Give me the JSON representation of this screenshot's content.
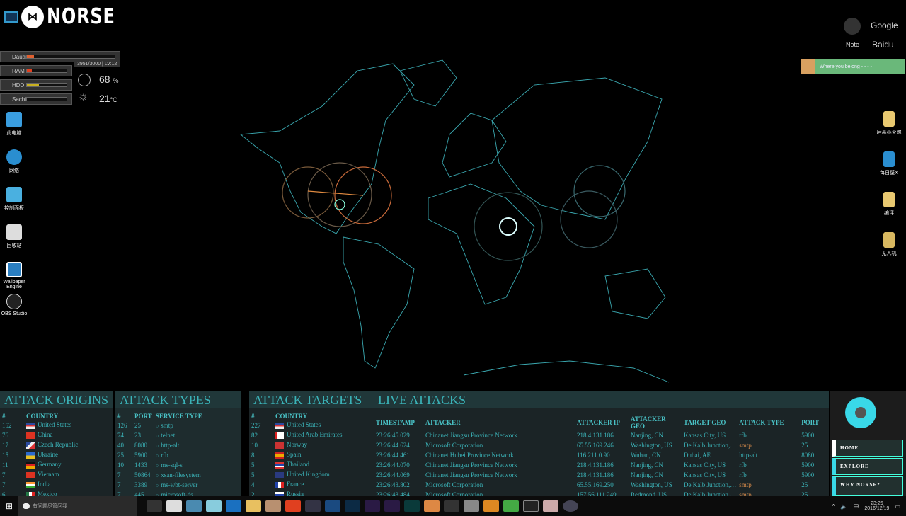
{
  "brand": {
    "name": "NORSE"
  },
  "system_widget": {
    "meters": [
      {
        "label": "Dauan",
        "fill": 0.08,
        "color": "#e06030"
      },
      {
        "label": "RAM",
        "fill": 0.12,
        "color": "#e04020"
      },
      {
        "label": "HDD",
        "fill": 0.3,
        "color": "#c8b020"
      },
      {
        "label": "Sachi",
        "fill": 0,
        "color": "#333"
      }
    ],
    "counter": "3951/3000",
    "level": "LV:12",
    "cpu_value": "68",
    "cpu_unit": "%",
    "temp_value": "21",
    "temp_unit": "°C"
  },
  "desktop_icons_left": [
    "此电脑",
    "网络",
    "控制面板",
    "回收站",
    "Wallpaper Engine",
    "OBS Studio"
  ],
  "desktop_icons_right": [
    "后悬小火炮",
    "每日壁X",
    "编评",
    "无人机"
  ],
  "quick_links": {
    "note": "Note",
    "google": "Google",
    "baidu": "Baidu"
  },
  "music_player": {
    "track": "Where you belong - - - -"
  },
  "attack_origins": {
    "title": "ATTACK ORIGINS",
    "headers": [
      "#",
      "COUNTRY"
    ],
    "rows": [
      [
        "152",
        "United States",
        "us"
      ],
      [
        "76",
        "China",
        "cn"
      ],
      [
        "17",
        "Czech Republic",
        "cz"
      ],
      [
        "15",
        "Ukraine",
        "ua"
      ],
      [
        "11",
        "Germany",
        "de"
      ],
      [
        "7",
        "Vietnam",
        "vn"
      ],
      [
        "7",
        "India",
        "in"
      ],
      [
        "6",
        "Mexico",
        "mx"
      ]
    ]
  },
  "attack_types": {
    "title": "ATTACK TYPES",
    "headers": [
      "#",
      "PORT",
      "SERVICE TYPE"
    ],
    "rows": [
      [
        "126",
        "25",
        "smtp"
      ],
      [
        "74",
        "23",
        "telnet"
      ],
      [
        "40",
        "8080",
        "http-alt"
      ],
      [
        "25",
        "5900",
        "rfb"
      ],
      [
        "10",
        "1433",
        "ms-sql-s"
      ],
      [
        "7",
        "50864",
        "xsan-filesystem"
      ],
      [
        "7",
        "3389",
        "ms-wbt-server"
      ],
      [
        "7",
        "445",
        "microsoft-ds"
      ]
    ]
  },
  "attack_targets": {
    "title": "ATTACK TARGETS",
    "headers": [
      "#",
      "COUNTRY"
    ],
    "rows": [
      [
        "227",
        "United States",
        "us"
      ],
      [
        "82",
        "United Arab Emirates",
        "ae"
      ],
      [
        "10",
        "Norway",
        "no"
      ],
      [
        "8",
        "Spain",
        "es"
      ],
      [
        "5",
        "Thailand",
        "th"
      ],
      [
        "5",
        "United Kingdom",
        "gb"
      ],
      [
        "4",
        "France",
        "fr"
      ],
      [
        "2",
        "Russia",
        "ru"
      ]
    ]
  },
  "live_attacks": {
    "title": "LIVE ATTACKS",
    "headers": [
      "TIMESTAMP",
      "ATTACKER",
      "ATTACKER IP",
      "ATTACKER GEO",
      "TARGET GEO",
      "ATTACK TYPE",
      "PORT"
    ],
    "rows": [
      [
        "23:26:45.029",
        "Chinanet Jiangsu Province Network",
        "218.4.131.186",
        "Nanjing, CN",
        "Kansas City, US",
        "rfb",
        "5900"
      ],
      [
        "23:26:44.624",
        "Microsoft Corporation",
        "65.55.169.246",
        "Washington, US",
        "De Kalb Junction,…",
        "smtp",
        "25"
      ],
      [
        "23:26:44.461",
        "Chinanet Hubei Province Network",
        "116.211.0.90",
        "Wuhan, CN",
        "Dubai, AE",
        "http-alt",
        "8080"
      ],
      [
        "23:26:44.070",
        "Chinanet Jiangsu Province Network",
        "218.4.131.186",
        "Nanjing, CN",
        "Kansas City, US",
        "rfb",
        "5900"
      ],
      [
        "23:26:44.069",
        "Chinanet Jiangsu Province Network",
        "218.4.131.186",
        "Nanjing, CN",
        "Kansas City, US",
        "rfb",
        "5900"
      ],
      [
        "23:26:43.802",
        "Microsoft Corporation",
        "65.55.169.250",
        "Washington, US",
        "De Kalb Junction,…",
        "smtp",
        "25"
      ],
      [
        "23:26:43.484",
        "Microsoft Corporation",
        "157.56.111.249",
        "Redmond, US",
        "De Kalb Junction,…",
        "smtp",
        "25"
      ]
    ]
  },
  "nav": {
    "home": "HOME",
    "explore": "EXPLORE",
    "why": "WHY NORSE?"
  },
  "taskbar": {
    "search_placeholder": "有问题尽管问我",
    "time": "23:26",
    "date": "2016/12/19",
    "ime": "中"
  },
  "colors": {
    "accent": "#3bb3b8",
    "panel": "#1b2426",
    "nav": "#39d8e8"
  }
}
